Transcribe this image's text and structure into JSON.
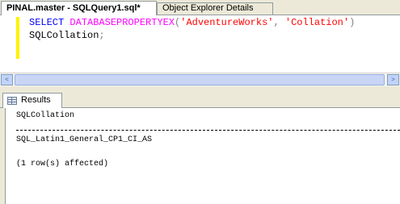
{
  "document_tabs": [
    {
      "label": "PINAL.master - SQLQuery1.sql*",
      "active": true
    },
    {
      "label": "Object Explorer Details",
      "active": false
    }
  ],
  "editor": {
    "line1": {
      "keyword": "SELECT",
      "function": "DATABASEPROPERTYEX",
      "open_paren": "(",
      "arg1": "'AdventureWorks'",
      "comma": ",",
      "arg2": "'Collation'",
      "close_paren": ")"
    },
    "line2": {
      "identifier": "SQLCollation",
      "terminator": ";"
    }
  },
  "scrollbar": {
    "left_arrow": "<",
    "right_arrow": ">"
  },
  "results_tab": {
    "label": "Results"
  },
  "results": {
    "column_header": "SQLCollation",
    "value": "SQL_Latin1_General_CP1_CI_AS",
    "status": "(1 row(s) affected)"
  },
  "colors": {
    "keyword": "#0000FF",
    "function": "#FF00FF",
    "string": "#FF0000",
    "operator": "#808080",
    "change_marker": "#FFF200"
  }
}
